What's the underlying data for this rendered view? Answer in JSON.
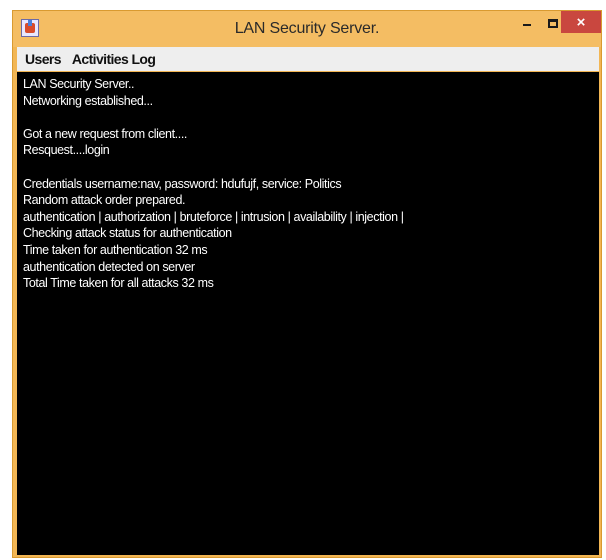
{
  "window": {
    "title": "LAN Security Server.",
    "close_label": "×",
    "icons": {
      "app": "java-app-icon",
      "minimize": "minimize-icon",
      "maximize": "maximize-icon",
      "close": "close-icon"
    },
    "colors": {
      "frame": "#f2b654",
      "close_button": "#c9473f",
      "console_bg": "#000000",
      "console_text": "#ffffff"
    }
  },
  "menubar": {
    "items": [
      {
        "label": "Users"
      },
      {
        "label": "Activities Log"
      }
    ]
  },
  "console": {
    "lines": [
      "LAN Security Server..",
      "Networking established...",
      "",
      "Got a new request from client....",
      "Resquest....login",
      "",
      "Credentials username:nav, password: hdufujf, service: Politics",
      "Random attack order prepared.",
      "authentication | authorization | bruteforce | intrusion | availability | injection |",
      "Checking attack status for authentication",
      "Time taken for authentication 32 ms",
      "authentication detected on server",
      "Total Time taken for all attacks 32 ms"
    ]
  }
}
